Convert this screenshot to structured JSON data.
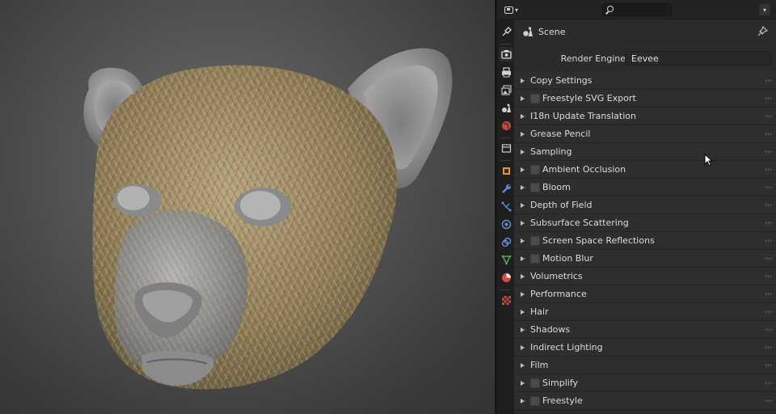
{
  "header": {
    "search_placeholder": ""
  },
  "context": {
    "label": "Scene"
  },
  "render_engine": {
    "label": "Render Engine",
    "value": "Eevee"
  },
  "panels": [
    {
      "label": "Copy Settings",
      "checkbox": false
    },
    {
      "label": "Freestyle SVG Export",
      "checkbox": true
    },
    {
      "label": "I18n Update Translation",
      "checkbox": false
    },
    {
      "label": "Grease Pencil",
      "checkbox": false
    },
    {
      "label": "Sampling",
      "checkbox": false
    },
    {
      "label": "Ambient Occlusion",
      "checkbox": true
    },
    {
      "label": "Bloom",
      "checkbox": true
    },
    {
      "label": "Depth of Field",
      "checkbox": false
    },
    {
      "label": "Subsurface Scattering",
      "checkbox": false
    },
    {
      "label": "Screen Space Reflections",
      "checkbox": true
    },
    {
      "label": "Motion Blur",
      "checkbox": true
    },
    {
      "label": "Volumetrics",
      "checkbox": false
    },
    {
      "label": "Performance",
      "checkbox": false
    },
    {
      "label": "Hair",
      "checkbox": false
    },
    {
      "label": "Shadows",
      "checkbox": false
    },
    {
      "label": "Indirect Lighting",
      "checkbox": false
    },
    {
      "label": "Film",
      "checkbox": false
    },
    {
      "label": "Simplify",
      "checkbox": true
    },
    {
      "label": "Freestyle",
      "checkbox": true
    }
  ],
  "tabs": [
    {
      "name": "tool-tab",
      "icon": "tool-icon"
    },
    {
      "name": "render-tab",
      "icon": "camera-back-icon",
      "active": true
    },
    {
      "name": "output-tab",
      "icon": "printer-icon"
    },
    {
      "name": "view-layer-tab",
      "icon": "image-stack-icon"
    },
    {
      "name": "scene-tab",
      "icon": "scene-icon"
    },
    {
      "name": "world-tab",
      "icon": "world-icon"
    },
    {
      "name": "collection-tab",
      "icon": "box-icon"
    },
    {
      "name": "object-tab",
      "icon": "object-icon"
    },
    {
      "name": "modifiers-tab",
      "icon": "wrench-icon"
    },
    {
      "name": "particles-tab",
      "icon": "particles-icon"
    },
    {
      "name": "physics-tab",
      "icon": "physics-icon"
    },
    {
      "name": "constraints-tab",
      "icon": "constraint-icon"
    },
    {
      "name": "data-tab",
      "icon": "mesh-data-icon"
    },
    {
      "name": "material-tab",
      "icon": "material-icon"
    },
    {
      "name": "texture-tab",
      "icon": "checker-texture-icon"
    }
  ],
  "colors": {
    "panel_bg": "#2b2b2b",
    "header_bg": "#232323",
    "fur": "#9c8a64",
    "skin": "#9a9a9a"
  }
}
